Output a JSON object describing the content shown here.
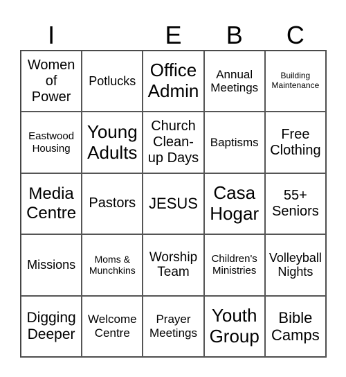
{
  "header": [
    "I",
    "",
    "E",
    "B",
    "C"
  ],
  "cells": [
    [
      "Women\nof\nPower",
      "Potlucks",
      "Office\nAdmin",
      "Annual\nMeetings",
      "Building\nMaintenance"
    ],
    [
      "Eastwood\nHousing",
      "Young\nAdults",
      "Church\nClean-\nup Days",
      "Baptisms",
      "Free\nClothing"
    ],
    [
      "Media\nCentre",
      "Pastors",
      "JESUS",
      "Casa\nHogar",
      "55+\nSeniors"
    ],
    [
      "Missions",
      "Moms &\nMunchkins",
      "Worship\nTeam",
      "Children's\nMinistries",
      "Volleyball\nNights"
    ],
    [
      "Digging\nDeeper",
      "Welcome\nCentre",
      "Prayer\nMeetings",
      "Youth\nGroup",
      "Bible\nCamps"
    ]
  ]
}
